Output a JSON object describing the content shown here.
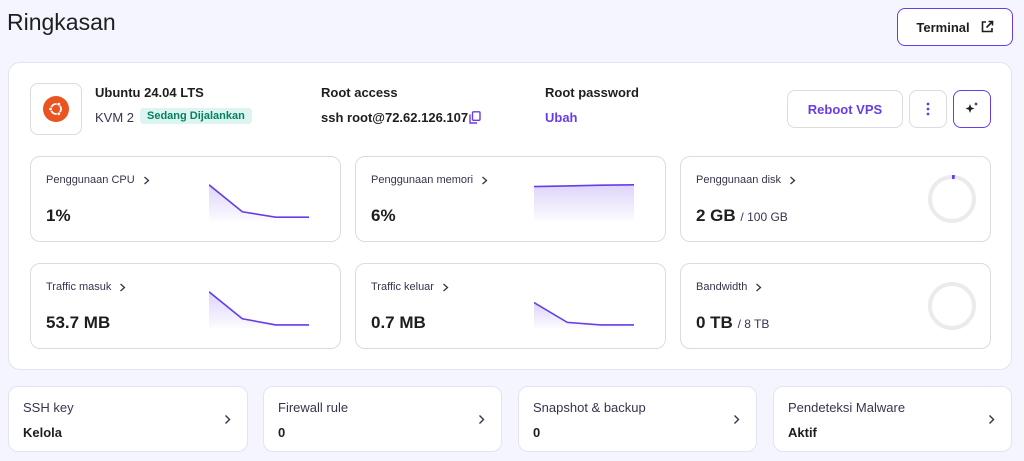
{
  "page": {
    "title": "Ringkasan"
  },
  "header": {
    "terminal_label": "Terminal",
    "terminal_icon": "external-link-icon"
  },
  "vps": {
    "os_name": "Ubuntu 24.04 LTS",
    "plan": "KVM 2",
    "status": "Sedang Dijalankan",
    "os_icon": "ubuntu-logo-icon",
    "root_access_label": "Root access",
    "root_access_value": "ssh root@72.62.126.107",
    "root_password_label": "Root password",
    "root_password_action": "Ubah",
    "reboot_label": "Reboot VPS"
  },
  "colors": {
    "accent": "#673de6",
    "status_bg": "#def4f0",
    "status_text": "#008361",
    "ubuntu": "#e95420"
  },
  "metrics": [
    {
      "label": "Penggunaan CPU",
      "value": "1%",
      "sub": "",
      "trend": [
        0.95,
        0.2,
        0.05,
        0.05
      ]
    },
    {
      "label": "Penggunaan memori",
      "value": "6%",
      "sub": "",
      "trend": [
        0.9,
        0.92,
        0.94,
        0.95
      ]
    },
    {
      "label": "Penggunaan disk",
      "value": "2 GB",
      "sub": "/ 100 GB",
      "fraction": 0.02
    },
    {
      "label": "Traffic masuk",
      "value": "53.7 MB",
      "sub": "",
      "trend": [
        0.95,
        0.2,
        0.03,
        0.03
      ]
    },
    {
      "label": "Traffic keluar",
      "value": "0.7 MB",
      "sub": "",
      "trend": [
        0.65,
        0.1,
        0.03,
        0.03
      ]
    },
    {
      "label": "Bandwidth",
      "value": "0 TB",
      "sub": "/ 8 TB",
      "fraction": 0.0
    }
  ],
  "bottom": [
    {
      "label": "SSH key",
      "value": "Kelola"
    },
    {
      "label": "Firewall rule",
      "value": "0"
    },
    {
      "label": "Snapshot & backup",
      "value": "0"
    },
    {
      "label": "Pendeteksi Malware",
      "value": "Aktif"
    }
  ]
}
